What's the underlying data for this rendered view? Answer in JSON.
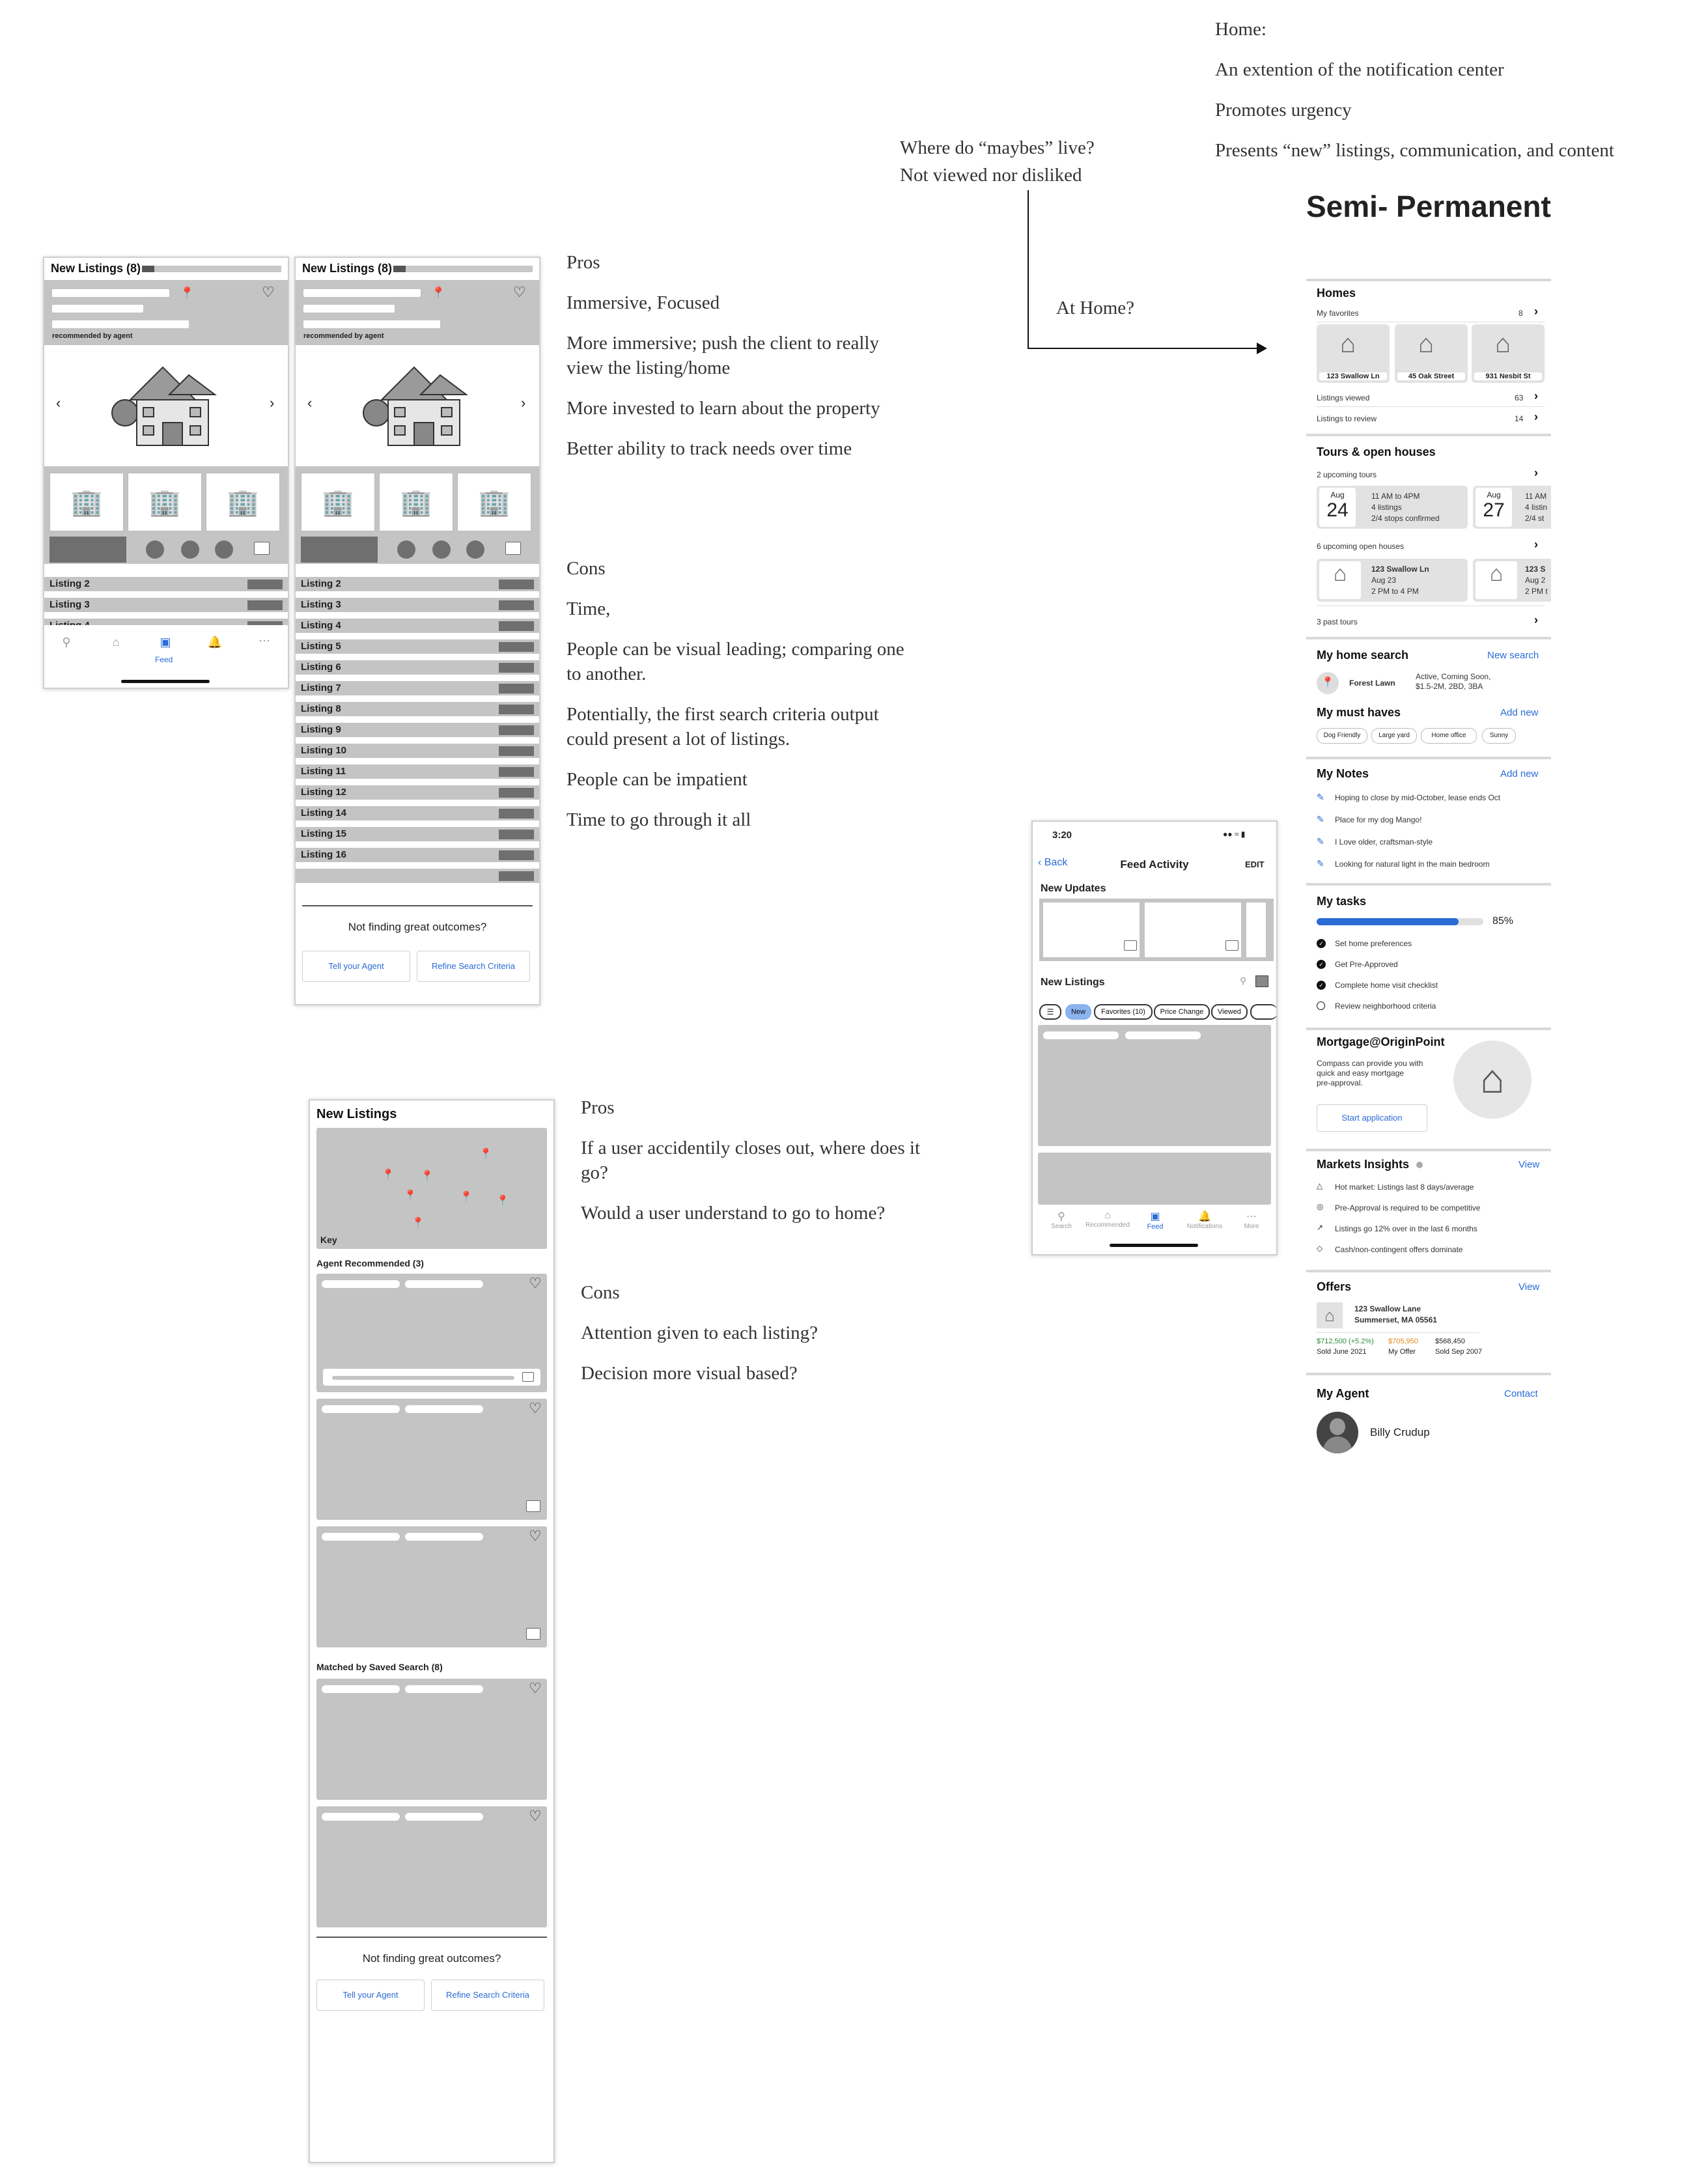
{
  "top_notes": {
    "home_lines": [
      "Home:",
      "An extention of the notification center",
      "Promotes urgency",
      "Presents “new” listings, communication, and content"
    ],
    "maybes_lines": [
      "Where do “maybes” live?",
      "Not viewed nor disliked"
    ],
    "at_home": "At Home?",
    "semi_permanent": "Semi- Permanent"
  },
  "phone1": {
    "title": "New Listings (8)",
    "progress": 0.09,
    "recommended": "recommended by agent",
    "listings": [
      "Listing 2",
      "Listing 3",
      "Listing 4"
    ],
    "tab_feed": "Feed"
  },
  "phone2": {
    "title": "New Listings (8)",
    "progress": 0.09,
    "recommended": "recommended by agent",
    "listings": [
      "Listing 2",
      "Listing 3",
      "Listing 4",
      "Listing 5",
      "Listing 6",
      "Listing 7",
      "Listing 8",
      "Listing 9",
      "Listing 10",
      "Listing 11",
      "Listing 12",
      "Listing 14",
      "Listing 15",
      "Listing 16",
      ""
    ],
    "not_finding": "Not finding great outcomes?",
    "btn_agent": "Tell your Agent",
    "btn_refine": "Refine Search Criteria"
  },
  "notes_top": {
    "pros": [
      "Pros",
      "Immersive, Focused",
      "More immersive; push the client to really view the listing/home",
      "More invested to learn about the property",
      "Better ability to track needs over time"
    ],
    "cons": [
      "Cons",
      "Time,",
      "People can be visual leading; comparing one to another.",
      "Potentially, the first search criteria output could present a lot of listings.",
      "People can be impatient",
      "Time to go through it all"
    ]
  },
  "phone3": {
    "title": "New Listings",
    "map_key": "Key",
    "agent_rec": "Agent Recommended (3)",
    "matched": "Matched by Saved Search (8)",
    "not_finding": "Not finding great outcomes?",
    "btn_agent": "Tell your Agent",
    "btn_refine": "Refine Search Criteria"
  },
  "notes_bottom": {
    "pros": [
      "Pros",
      "If a user accidentily closes out, where does it go?",
      "Would a user understand to go to home?"
    ],
    "cons": [
      "Cons",
      "Attention given to each listing?",
      "Decision more visual based?"
    ]
  },
  "feed_phone": {
    "time": "3:20",
    "back": "Back",
    "title": "Feed Activity",
    "edit": "EDIT",
    "new_updates": "New Updates",
    "new_listings": "New Listings",
    "filters": [
      "New",
      "Favorites (10)",
      "Price Change",
      "Viewed"
    ],
    "tabs": [
      "Search",
      "Recommended",
      "Feed",
      "Notifications",
      "More"
    ]
  },
  "home_panel": {
    "homes": {
      "title": "Homes",
      "my_favorites": "My favorites",
      "fav_count": "8",
      "cards": [
        "123 Swallow Ln",
        "45 Oak Street",
        "931 Nesbit St"
      ],
      "viewed_label": "Listings viewed",
      "viewed_count": "63",
      "review_label": "Listings to review",
      "review_count": "14"
    },
    "tours": {
      "title": "Tours & open houses",
      "upcoming": "2 upcoming tours",
      "t1_month": "Aug",
      "t1_day": "24",
      "t1_lines": [
        "11 AM to 4PM",
        "4 listings",
        "2/4 stops confirmed"
      ],
      "t2_month": "Aug",
      "t2_day": "27",
      "t2_lines": [
        "11 AM",
        "4 listin",
        "2/4 st"
      ],
      "open_houses": "6 upcoming open houses",
      "oh1_lines": [
        "123 Swallow Ln",
        "Aug 23",
        "2 PM to 4 PM"
      ],
      "oh2_lines": [
        "123 S",
        "Aug 2",
        "2 PM t"
      ],
      "past": "3 past tours"
    },
    "search": {
      "title": "My home search",
      "link": "New search",
      "place": "Forest Lawn",
      "criteria_1": "Active, Coming Soon,",
      "criteria_2": "$1.5-2M, 2BD, 3BA"
    },
    "must_haves": {
      "title": "My must haves",
      "link": "Add new",
      "chips": [
        "Dog Friendly",
        "Large yard",
        "Home office",
        "Sunny"
      ]
    },
    "notes": {
      "title": "My Notes",
      "link": "Add new",
      "items": [
        "Hoping to close by mid-October, lease ends Oct",
        "Place for my dog Mango!",
        "I Love older, craftsman-style",
        "Looking for natural light in the main bedroom"
      ]
    },
    "tasks": {
      "title": "My tasks",
      "percent": "85%",
      "progress": 0.85,
      "items": [
        "Set home preferences",
        "Get Pre-Approved",
        "Complete home visit checklist",
        "Review neighborhood criteria"
      ],
      "done": [
        true,
        true,
        true,
        false
      ]
    },
    "mortgage": {
      "title": "Mortgage@OriginPoint",
      "body": [
        "Compass can provide you with",
        "quick and easy mortgage",
        "pre-approval."
      ],
      "button": "Start application"
    },
    "insights": {
      "title": "Markets Insights",
      "link": "View",
      "items": [
        "Hot market: Listings last 8 days/average",
        "Pre-Approval is required to be competitive",
        "Listings go 12% over in the last 6 months",
        "Cash/non-contingent offers dominate"
      ]
    },
    "offers": {
      "title": "Offers",
      "link": "View",
      "addr1": "123 Swallow Lane",
      "addr2": "Summerset, MA 05561",
      "v1": "$712,500 (+5.2%)",
      "v1_sub": "Sold June 2021",
      "v2": "$705,950",
      "v2_sub": "My Offer",
      "v3": "$568,450",
      "v3_sub": "Sold Sep 2007",
      "green": "#2e8b3a",
      "orange": "#e08a1e"
    },
    "agent": {
      "title": "My Agent",
      "link": "Contact",
      "name": "Billy Crudup"
    }
  },
  "colors": {
    "accent": "#2a6bd6",
    "placeholder": "#c4c4c4",
    "dark_block": "#6f6f6f"
  }
}
